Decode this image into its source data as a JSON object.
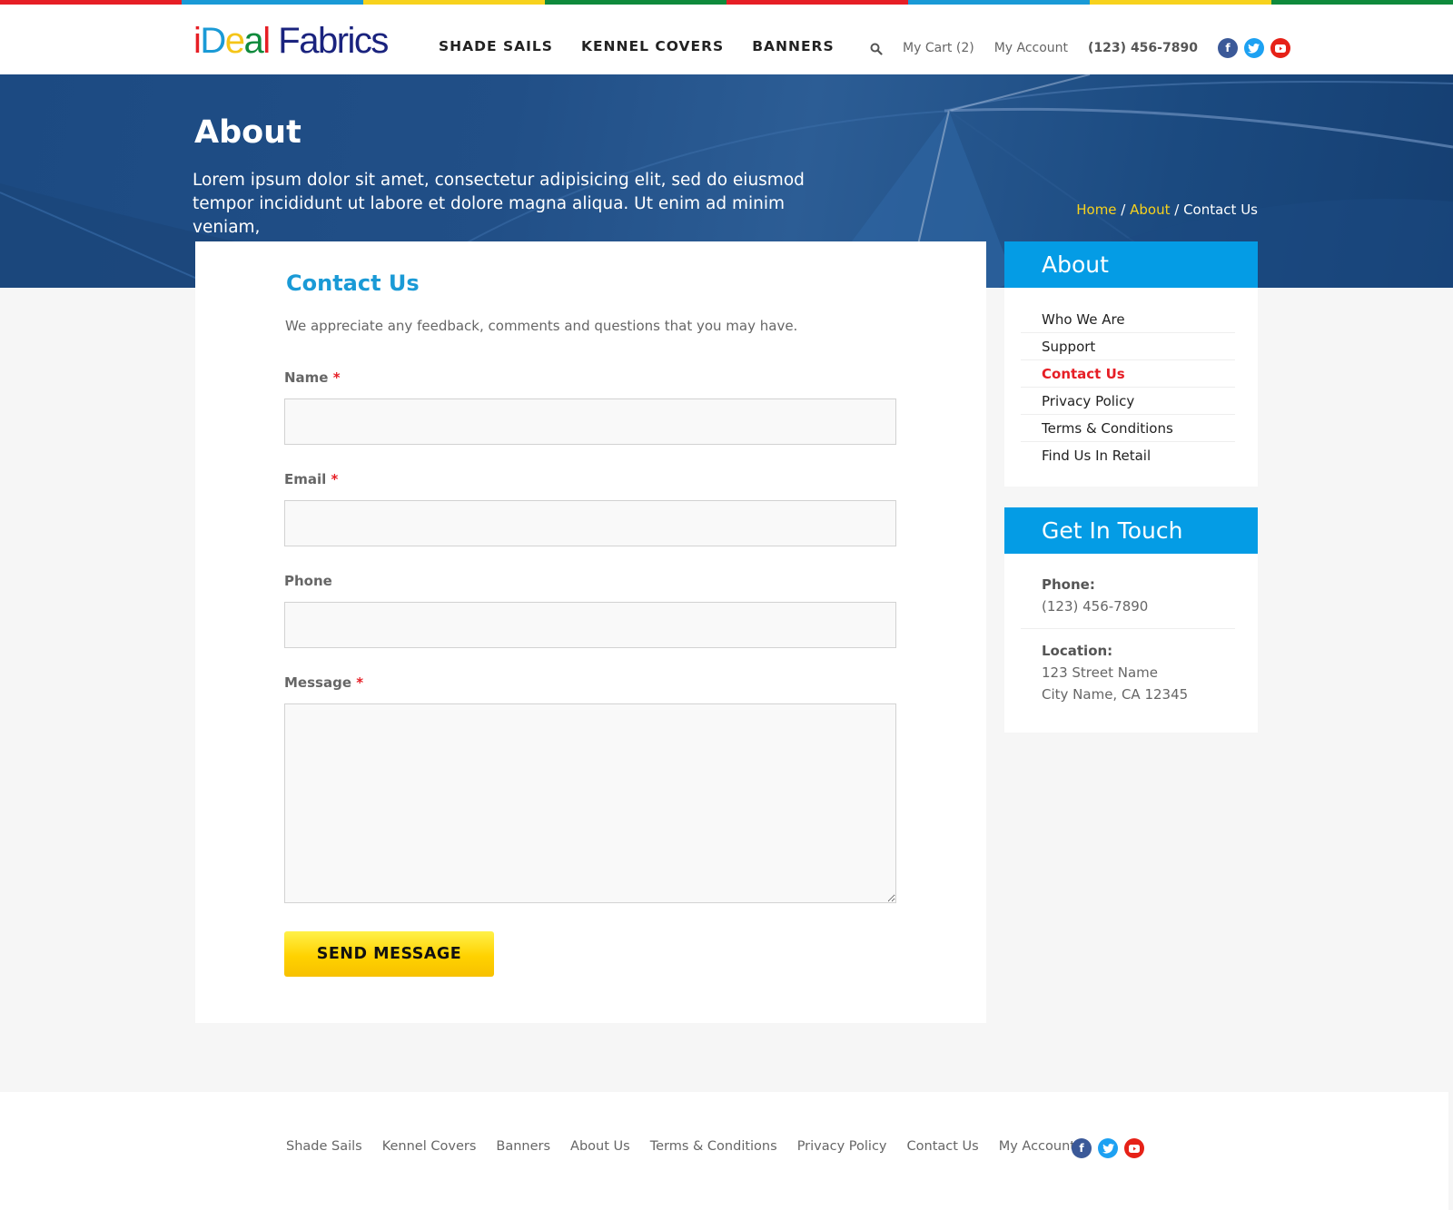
{
  "colors": {
    "stripe": [
      "#e61e25",
      "#1a9ad6",
      "#f7d21d",
      "#0f8a3c",
      "#e61e25",
      "#1a9ad6",
      "#f7d21d",
      "#0f8a3c"
    ],
    "accent_blue": "#049ce5",
    "required_red": "#e61e25",
    "button_yellow": "#ffd200"
  },
  "header": {
    "logo": {
      "part1": "i",
      "part2": "D",
      "part3": "e",
      "part4": "a",
      "part5": "l",
      "part6": " Fabrics"
    },
    "nav": [
      "SHADE SAILS",
      "KENNEL COVERS",
      "BANNERS"
    ],
    "cart": "My Cart (2)",
    "account": "My Account",
    "phone": "(123) 456-7890",
    "icons": [
      "search-icon",
      "facebook-icon",
      "twitter-icon",
      "youtube-icon"
    ]
  },
  "hero": {
    "title": "About",
    "text": "Lorem ipsum dolor sit amet, consectetur adipisicing elit, sed do eiusmod tempor incididunt ut labore et dolore magna aliqua. Ut enim ad minim veniam,",
    "breadcrumb": {
      "home": "Home",
      "about": "About",
      "current": "Contact Us",
      "sep": " / "
    }
  },
  "form": {
    "title": "Contact Us",
    "intro": "We appreciate any feedback, comments and questions that you may have.",
    "name_label": "Name",
    "email_label": "Email",
    "phone_label": "Phone",
    "message_label": "Message",
    "required_mark": "*",
    "submit": "SEND MESSAGE"
  },
  "sidebar": {
    "about_title": "About",
    "about_items": [
      "Who We Are",
      "Support",
      "Contact Us",
      "Privacy Policy",
      "Terms & Conditions",
      "Find Us In Retail"
    ],
    "active_item": "Contact Us",
    "touch_title": "Get In Touch",
    "phone_label": "Phone:",
    "phone_value": "(123) 456-7890",
    "location_label": "Location:",
    "location_line1": "123 Street Name",
    "location_line2": "City Name, CA 12345"
  },
  "footer": {
    "links": [
      "Shade Sails",
      "Kennel Covers",
      "Banners",
      "About Us",
      "Terms & Conditions",
      "Privacy Policy",
      "Contact Us",
      "My Account"
    ]
  }
}
